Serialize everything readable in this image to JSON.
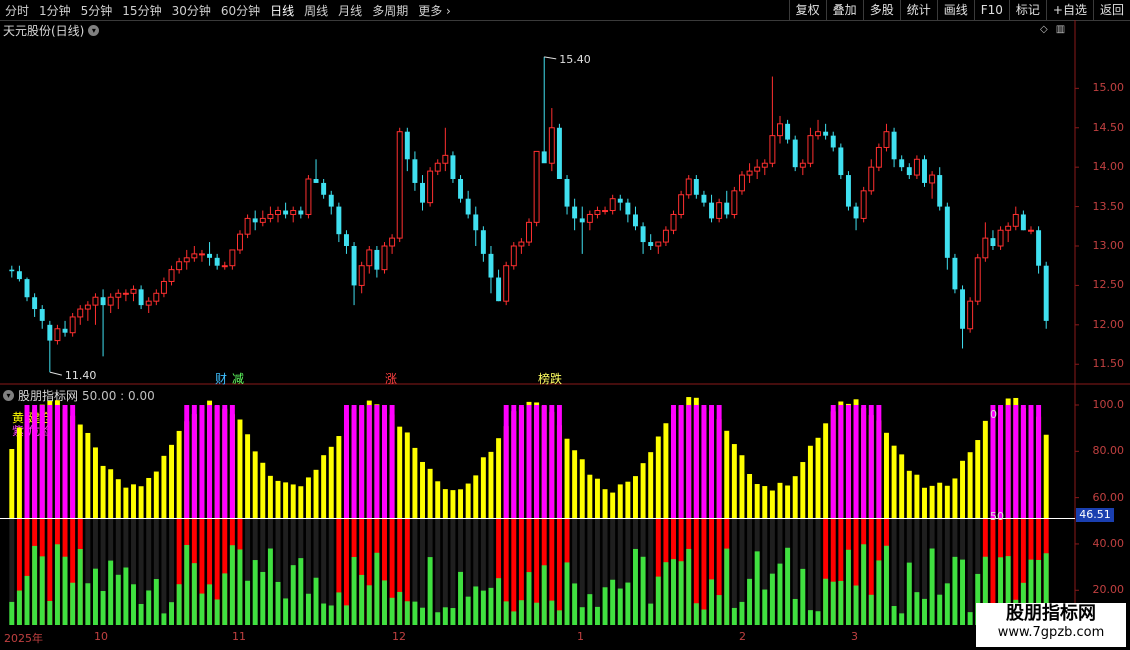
{
  "toolbar": {
    "periods": [
      "分时",
      "1分钟",
      "5分钟",
      "15分钟",
      "30分钟",
      "60分钟",
      "日线",
      "周线",
      "月线",
      "多周期",
      "更多"
    ],
    "active_period": "日线",
    "more_label": "更多",
    "right_buttons": [
      "复权",
      "叠加",
      "多股",
      "统计",
      "画线",
      "F10",
      "标记",
      "+自选",
      "返回"
    ]
  },
  "main_chart": {
    "title": "天元股份(日线)",
    "high_label": "15.40",
    "low_label": "11.40",
    "y_ticks": [
      "15.00",
      "14.50",
      "14.00",
      "13.50",
      "13.00",
      "12.50",
      "12.00",
      "11.50"
    ],
    "events": [
      {
        "text": "财",
        "color": "#40c0ff"
      },
      {
        "text": "减",
        "color": "#60ff60"
      },
      {
        "text": "涨",
        "color": "#ff4040"
      },
      {
        "text": "榜跌",
        "color": "#ffff60"
      }
    ]
  },
  "indicator": {
    "title": "股朋指标网",
    "values": "50.00 : 0.00",
    "legend": [
      "黄:建仓",
      "紫:危险"
    ],
    "y_ticks": [
      "100.0",
      "80.00",
      "60.00",
      "40.00",
      "20.00"
    ],
    "current_value": "46.51",
    "level_label_0": "0",
    "level_label_50": "50"
  },
  "x_axis": [
    "2025年",
    "10",
    "11",
    "12",
    "1",
    "2",
    "3"
  ],
  "watermark": {
    "line1": "股朋指标网",
    "line2": "www.7gpzb.com"
  },
  "colors": {
    "up": "#ff3030",
    "down": "#40e0f0",
    "yellow": "#ffff00",
    "magenta": "#ff00ff",
    "red": "#ff0000",
    "green": "#40e040",
    "axis": "#c04040"
  },
  "chart_data": {
    "type": "candlestick",
    "y_range": [
      11.3,
      15.55
    ],
    "candles": [
      [
        12.7,
        12.75,
        12.6,
        12.68
      ],
      [
        12.68,
        12.75,
        12.55,
        12.58
      ],
      [
        12.58,
        12.6,
        12.3,
        12.35
      ],
      [
        12.35,
        12.4,
        12.1,
        12.2
      ],
      [
        12.2,
        12.25,
        11.95,
        12.05
      ],
      [
        12.0,
        12.05,
        11.4,
        11.8
      ],
      [
        11.8,
        12.0,
        11.75,
        11.95
      ],
      [
        11.95,
        12.05,
        11.85,
        11.9
      ],
      [
        11.9,
        12.15,
        11.85,
        12.1
      ],
      [
        12.1,
        12.25,
        12.0,
        12.2
      ],
      [
        12.2,
        12.3,
        12.05,
        12.25
      ],
      [
        12.25,
        12.4,
        12.0,
        12.35
      ],
      [
        12.35,
        12.45,
        11.6,
        12.25
      ],
      [
        12.25,
        12.4,
        12.15,
        12.35
      ],
      [
        12.35,
        12.45,
        12.2,
        12.4
      ],
      [
        12.4,
        12.45,
        12.3,
        12.4
      ],
      [
        12.4,
        12.5,
        12.3,
        12.45
      ],
      [
        12.45,
        12.5,
        12.2,
        12.25
      ],
      [
        12.25,
        12.35,
        12.15,
        12.3
      ],
      [
        12.3,
        12.45,
        12.25,
        12.4
      ],
      [
        12.4,
        12.6,
        12.35,
        12.55
      ],
      [
        12.55,
        12.75,
        12.5,
        12.7
      ],
      [
        12.7,
        12.85,
        12.65,
        12.8
      ],
      [
        12.8,
        12.95,
        12.7,
        12.85
      ],
      [
        12.85,
        13.0,
        12.8,
        12.9
      ],
      [
        12.9,
        12.95,
        12.8,
        12.9
      ],
      [
        12.9,
        13.05,
        12.75,
        12.85
      ],
      [
        12.85,
        12.9,
        12.7,
        12.75
      ],
      [
        12.75,
        12.8,
        12.7,
        12.75
      ],
      [
        12.75,
        12.95,
        12.7,
        12.95
      ],
      [
        12.95,
        13.2,
        12.9,
        13.15
      ],
      [
        13.15,
        13.4,
        13.1,
        13.35
      ],
      [
        13.35,
        13.45,
        13.2,
        13.3
      ],
      [
        13.3,
        13.45,
        13.25,
        13.35
      ],
      [
        13.35,
        13.5,
        13.3,
        13.4
      ],
      [
        13.4,
        13.5,
        13.3,
        13.45
      ],
      [
        13.45,
        13.55,
        13.35,
        13.4
      ],
      [
        13.4,
        13.5,
        13.3,
        13.45
      ],
      [
        13.45,
        13.5,
        13.35,
        13.4
      ],
      [
        13.4,
        13.9,
        13.35,
        13.85
      ],
      [
        13.85,
        14.1,
        13.8,
        13.8
      ],
      [
        13.8,
        13.85,
        13.6,
        13.65
      ],
      [
        13.65,
        13.7,
        13.4,
        13.5
      ],
      [
        13.5,
        13.55,
        13.05,
        13.15
      ],
      [
        13.15,
        13.2,
        12.9,
        13.0
      ],
      [
        13.0,
        13.05,
        12.25,
        12.5
      ],
      [
        12.5,
        12.8,
        12.4,
        12.75
      ],
      [
        12.75,
        13.0,
        12.65,
        12.95
      ],
      [
        12.95,
        13.0,
        12.6,
        12.7
      ],
      [
        12.7,
        13.05,
        12.65,
        13.0
      ],
      [
        13.0,
        13.15,
        12.9,
        13.1
      ],
      [
        13.1,
        14.5,
        13.05,
        14.45
      ],
      [
        14.45,
        14.5,
        13.95,
        14.1
      ],
      [
        14.1,
        14.2,
        13.7,
        13.8
      ],
      [
        13.8,
        13.9,
        13.45,
        13.55
      ],
      [
        13.55,
        14.0,
        13.5,
        13.95
      ],
      [
        13.95,
        14.1,
        13.9,
        14.05
      ],
      [
        14.05,
        14.5,
        13.95,
        14.15
      ],
      [
        14.15,
        14.2,
        13.8,
        13.85
      ],
      [
        13.85,
        13.9,
        13.55,
        13.6
      ],
      [
        13.6,
        13.7,
        13.35,
        13.4
      ],
      [
        13.4,
        13.5,
        13.0,
        13.2
      ],
      [
        13.2,
        13.25,
        12.8,
        12.9
      ],
      [
        12.9,
        13.0,
        12.4,
        12.6
      ],
      [
        12.6,
        12.7,
        12.3,
        12.3
      ],
      [
        12.3,
        12.8,
        12.25,
        12.75
      ],
      [
        12.75,
        13.05,
        12.7,
        13.0
      ],
      [
        13.0,
        13.1,
        12.9,
        13.05
      ],
      [
        13.05,
        13.35,
        13.0,
        13.3
      ],
      [
        13.3,
        14.2,
        13.25,
        14.2
      ],
      [
        14.2,
        15.4,
        14.1,
        14.05
      ],
      [
        14.05,
        14.75,
        13.95,
        14.5
      ],
      [
        14.5,
        14.55,
        13.85,
        13.85
      ],
      [
        13.85,
        13.9,
        13.4,
        13.5
      ],
      [
        13.5,
        13.6,
        13.2,
        13.35
      ],
      [
        13.35,
        13.5,
        12.9,
        13.3
      ],
      [
        13.3,
        13.45,
        13.2,
        13.4
      ],
      [
        13.4,
        13.5,
        13.35,
        13.45
      ],
      [
        13.45,
        13.5,
        13.4,
        13.45
      ],
      [
        13.45,
        13.65,
        13.4,
        13.6
      ],
      [
        13.6,
        13.65,
        13.45,
        13.55
      ],
      [
        13.55,
        13.6,
        13.3,
        13.4
      ],
      [
        13.4,
        13.5,
        13.2,
        13.25
      ],
      [
        13.25,
        13.3,
        12.9,
        13.05
      ],
      [
        13.05,
        13.15,
        12.95,
        13.0
      ],
      [
        13.0,
        13.05,
        12.9,
        13.05
      ],
      [
        13.05,
        13.25,
        13.0,
        13.2
      ],
      [
        13.2,
        13.45,
        13.15,
        13.4
      ],
      [
        13.4,
        13.7,
        13.35,
        13.65
      ],
      [
        13.65,
        13.9,
        13.6,
        13.85
      ],
      [
        13.85,
        13.9,
        13.6,
        13.65
      ],
      [
        13.65,
        13.7,
        13.5,
        13.55
      ],
      [
        13.55,
        13.65,
        13.3,
        13.35
      ],
      [
        13.35,
        13.6,
        13.3,
        13.55
      ],
      [
        13.55,
        13.7,
        13.35,
        13.4
      ],
      [
        13.4,
        13.75,
        13.35,
        13.7
      ],
      [
        13.7,
        13.95,
        13.65,
        13.9
      ],
      [
        13.9,
        14.05,
        13.8,
        13.95
      ],
      [
        13.95,
        14.1,
        13.85,
        14.0
      ],
      [
        14.0,
        14.1,
        13.9,
        14.05
      ],
      [
        14.05,
        15.15,
        14.0,
        14.4
      ],
      [
        14.4,
        14.65,
        14.3,
        14.55
      ],
      [
        14.55,
        14.6,
        14.3,
        14.35
      ],
      [
        14.35,
        14.4,
        13.95,
        14.0
      ],
      [
        14.0,
        14.1,
        13.9,
        14.05
      ],
      [
        14.05,
        14.5,
        14.0,
        14.4
      ],
      [
        14.4,
        14.6,
        14.35,
        14.45
      ],
      [
        14.45,
        14.55,
        14.35,
        14.4
      ],
      [
        14.4,
        14.45,
        14.2,
        14.25
      ],
      [
        14.25,
        14.3,
        13.85,
        13.9
      ],
      [
        13.9,
        13.95,
        13.45,
        13.5
      ],
      [
        13.5,
        13.55,
        13.2,
        13.35
      ],
      [
        13.35,
        13.75,
        13.3,
        13.7
      ],
      [
        13.7,
        14.1,
        13.65,
        14.0
      ],
      [
        14.0,
        14.3,
        13.95,
        14.25
      ],
      [
        14.25,
        14.55,
        14.2,
        14.45
      ],
      [
        14.45,
        14.5,
        14.0,
        14.1
      ],
      [
        14.1,
        14.15,
        13.95,
        14.0
      ],
      [
        14.0,
        14.05,
        13.85,
        13.9
      ],
      [
        13.9,
        14.15,
        13.85,
        14.1
      ],
      [
        14.1,
        14.15,
        13.75,
        13.8
      ],
      [
        13.8,
        13.95,
        13.6,
        13.9
      ],
      [
        13.9,
        14.0,
        13.45,
        13.5
      ],
      [
        13.5,
        13.55,
        12.7,
        12.85
      ],
      [
        12.85,
        12.9,
        12.4,
        12.45
      ],
      [
        12.45,
        12.5,
        11.7,
        11.95
      ],
      [
        11.95,
        12.35,
        11.9,
        12.3
      ],
      [
        12.3,
        12.9,
        12.25,
        12.85
      ],
      [
        12.85,
        13.3,
        12.8,
        13.1
      ],
      [
        13.1,
        13.2,
        12.95,
        13.0
      ],
      [
        13.0,
        13.25,
        12.95,
        13.2
      ],
      [
        13.2,
        13.3,
        13.05,
        13.25
      ],
      [
        13.25,
        13.5,
        13.2,
        13.4
      ],
      [
        13.4,
        13.45,
        13.2,
        13.2
      ],
      [
        13.2,
        13.25,
        13.15,
        13.2
      ],
      [
        13.2,
        13.25,
        12.65,
        12.75
      ],
      [
        12.75,
        12.8,
        11.95,
        12.05
      ]
    ]
  }
}
